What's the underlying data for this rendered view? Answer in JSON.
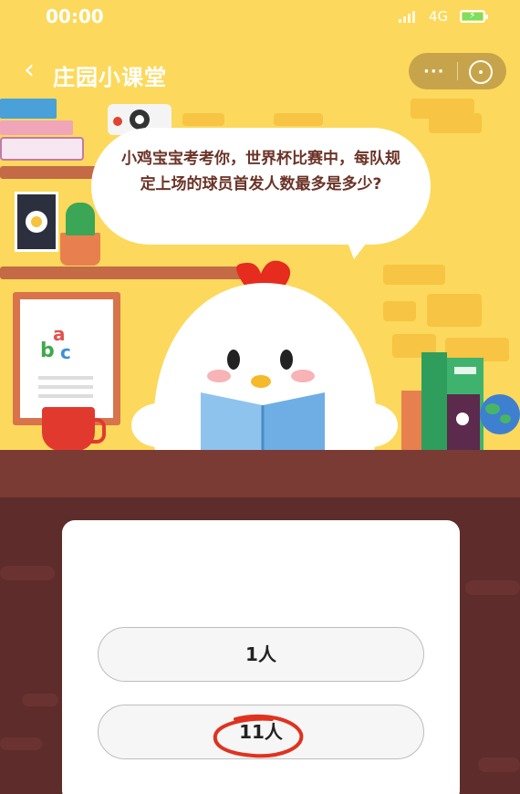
{
  "status_bar": {
    "time": "00:00",
    "network": "4G"
  },
  "nav": {
    "back_icon": "chevron-left-icon",
    "title": "庄园小课堂",
    "more_label": "···",
    "close_icon": "target-close-icon"
  },
  "question": {
    "text": "小鸡宝宝考考你，世界杯比赛中，每队规定上场的球员首发人数最多是多少?"
  },
  "options": [
    {
      "label": "1人"
    },
    {
      "label": "11人",
      "marked": true
    }
  ],
  "poster": {
    "letter_a": "a",
    "letter_b": "b",
    "letter_c": "c"
  },
  "colors": {
    "wall": "#fcd95c",
    "table": "#7a3b35",
    "card": "#ffffff",
    "mark": "#e0321e"
  }
}
